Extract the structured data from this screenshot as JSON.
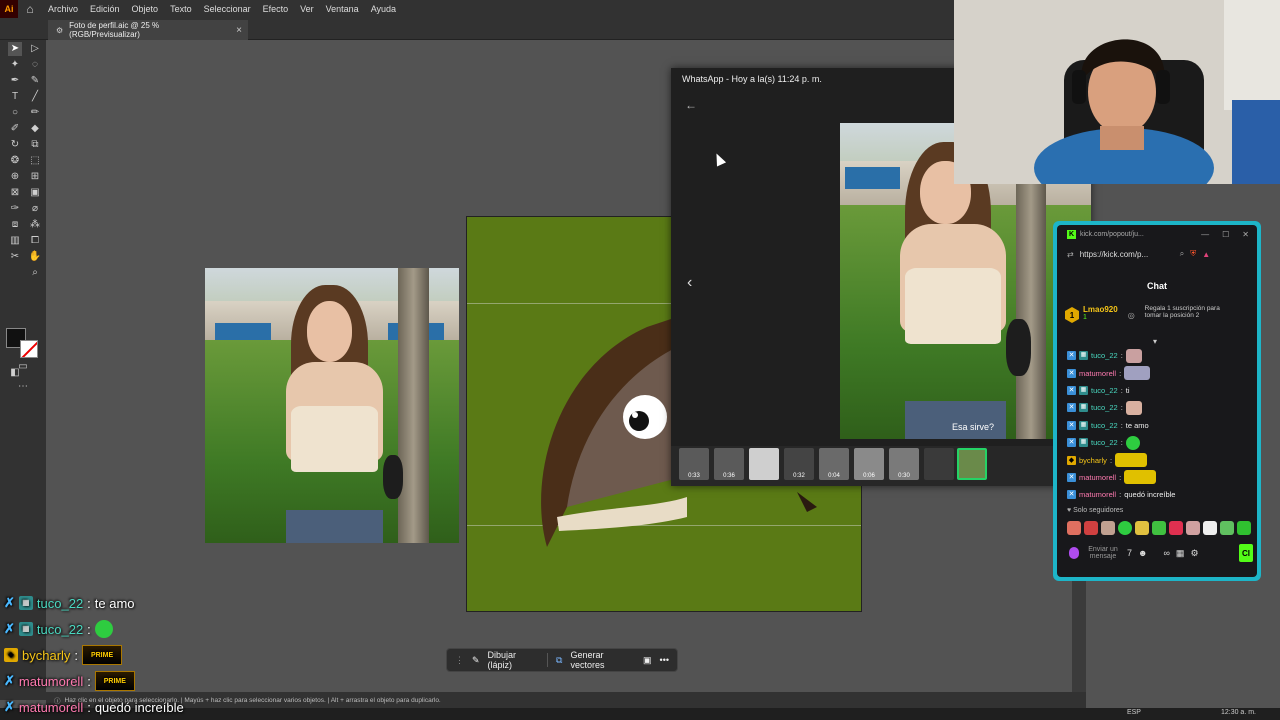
{
  "menu": {
    "app_logo": "Ai",
    "items": [
      "Archivo",
      "Edición",
      "Objeto",
      "Texto",
      "Seleccionar",
      "Efecto",
      "Ver",
      "Ventana",
      "Ayuda"
    ]
  },
  "document": {
    "tab_title": "Foto de perfil.aic @ 25 % (RGB/Previsualizar)",
    "close_glyph": "×"
  },
  "whatsapp": {
    "title": "WhatsApp - Hoy a la(s) 11:24 p. m.",
    "caption": "Esa sirve?",
    "thumbnails": [
      {
        "duration": "0:33"
      },
      {
        "duration": "0:36"
      },
      {
        "duration": ""
      },
      {
        "duration": "0:32"
      },
      {
        "duration": "0:04"
      },
      {
        "duration": "0:06"
      },
      {
        "duration": "0:30"
      },
      {
        "duration": ""
      },
      {
        "duration": ""
      }
    ]
  },
  "kick": {
    "window_title": "kick.com/popout/ju...",
    "url": "https://kick.com/p...",
    "chat_heading": "Chat",
    "pinned": {
      "username": "Lmao920",
      "count": "1",
      "note": "Regala 1 suscripción para tomar la posición 2"
    },
    "messages": [
      {
        "user": "tuco_22",
        "text": "",
        "emote": "#c9a0a0"
      },
      {
        "user": "matumorell",
        "text": "",
        "emote": "#a0a0c0"
      },
      {
        "user": "tuco_22",
        "text": "ti",
        "emote": ""
      },
      {
        "user": "tuco_22",
        "text": "",
        "emote": "#d8b0a0"
      },
      {
        "user": "tuco_22",
        "text": "te amo",
        "emote": ""
      },
      {
        "user": "tuco_22",
        "text": "",
        "emote": "#2ecc40"
      },
      {
        "user": "bycharly",
        "text": "",
        "emote": "#e0c000"
      },
      {
        "user": "matumorell",
        "text": "",
        "emote": "#e0c000"
      },
      {
        "user": "matumorell",
        "text": "quedó increíble",
        "emote": ""
      }
    ],
    "followers_only": "Solo seguidores",
    "input_placeholder": "Enviar un mensaje",
    "send_label": "Cl"
  },
  "taskbar": {
    "draw_label": "Dibujar (lápiz)",
    "vectors_label": "Generar vectores",
    "more_glyph": "•••"
  },
  "status": {
    "hint": "Haz clic en el objeto para seleccionarlo. | Mayús + haz clic para seleccionar varios objetos. | Alt + arrastra el objeto para duplicarlo."
  },
  "win_tray": {
    "lang": "ESP",
    "clock": "12:30 a. m."
  },
  "overlay": {
    "lines": [
      {
        "user": "tuco_22",
        "text": "te amo",
        "badge": "sub",
        "prime": false,
        "green": false
      },
      {
        "user": "tuco_22",
        "text": "",
        "badge": "sub",
        "prime": false,
        "green": true
      },
      {
        "user": "bycharly",
        "text": "",
        "badge": "gold",
        "prime": true,
        "green": false
      },
      {
        "user": "matumorell",
        "text": "",
        "badge": "x",
        "prime": true,
        "green": false
      },
      {
        "user": "matumorell",
        "text": "quedó increíble",
        "badge": "x",
        "prime": false,
        "green": false
      }
    ],
    "prime_label": "PRIME"
  },
  "colors": {
    "kick_accent": "#53fc18",
    "whatsapp_green": "#25d366",
    "artboard_bg": "#5a7a15",
    "kick_frame": "#1db5c8"
  }
}
